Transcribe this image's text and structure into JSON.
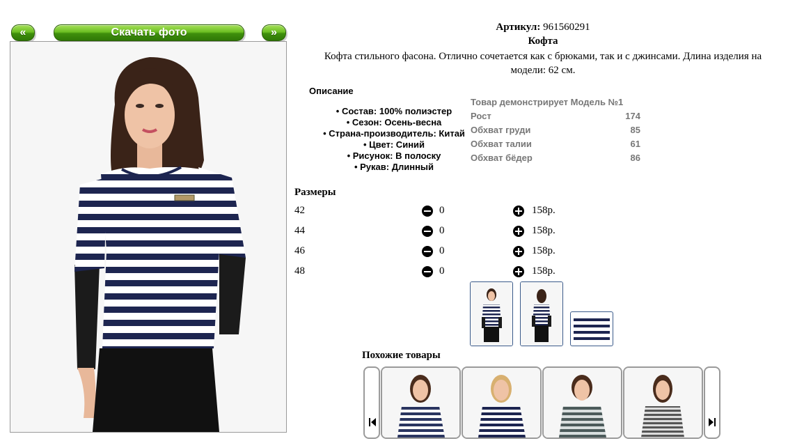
{
  "gallery": {
    "prev_label": "«",
    "download_label": "Скачать фото",
    "next_label": "»"
  },
  "product": {
    "article_label": "Артикул:",
    "article_value": "961560291",
    "name": "Кофта",
    "description": "Кофта стильного фасона. Отлично сочетается как с брюками, так и с джинсами. Длина изделия на модели: 62 см."
  },
  "specs": {
    "heading": "Описание",
    "items": [
      "Состав: 100% полиэстер",
      "Сезон: Осень-весна",
      "Страна-производитель: Китай",
      "Цвет: Синий",
      "Рисунок: В полоску",
      "Рукав: Длинный"
    ]
  },
  "model": {
    "heading": "Товар демонстрирует Модель №1",
    "rows": [
      {
        "label": "Рост",
        "value": "174"
      },
      {
        "label": "Обхват груди",
        "value": "85"
      },
      {
        "label": "Обхват талии",
        "value": "61"
      },
      {
        "label": "Обхват бёдер",
        "value": "86"
      }
    ]
  },
  "sizes": {
    "heading": "Размеры",
    "rows": [
      {
        "size": "42",
        "qty": "0",
        "price": "158р."
      },
      {
        "size": "44",
        "qty": "0",
        "price": "158р."
      },
      {
        "size": "46",
        "qty": "0",
        "price": "158р."
      },
      {
        "size": "48",
        "qty": "0",
        "price": "158р."
      }
    ]
  },
  "similar": {
    "heading": "Похожие товары"
  },
  "colors": {
    "button_green": "#4fa314",
    "navy_stripe": "#1d2550",
    "gray_text": "#777777",
    "thumb_border": "#3a5a8a"
  }
}
